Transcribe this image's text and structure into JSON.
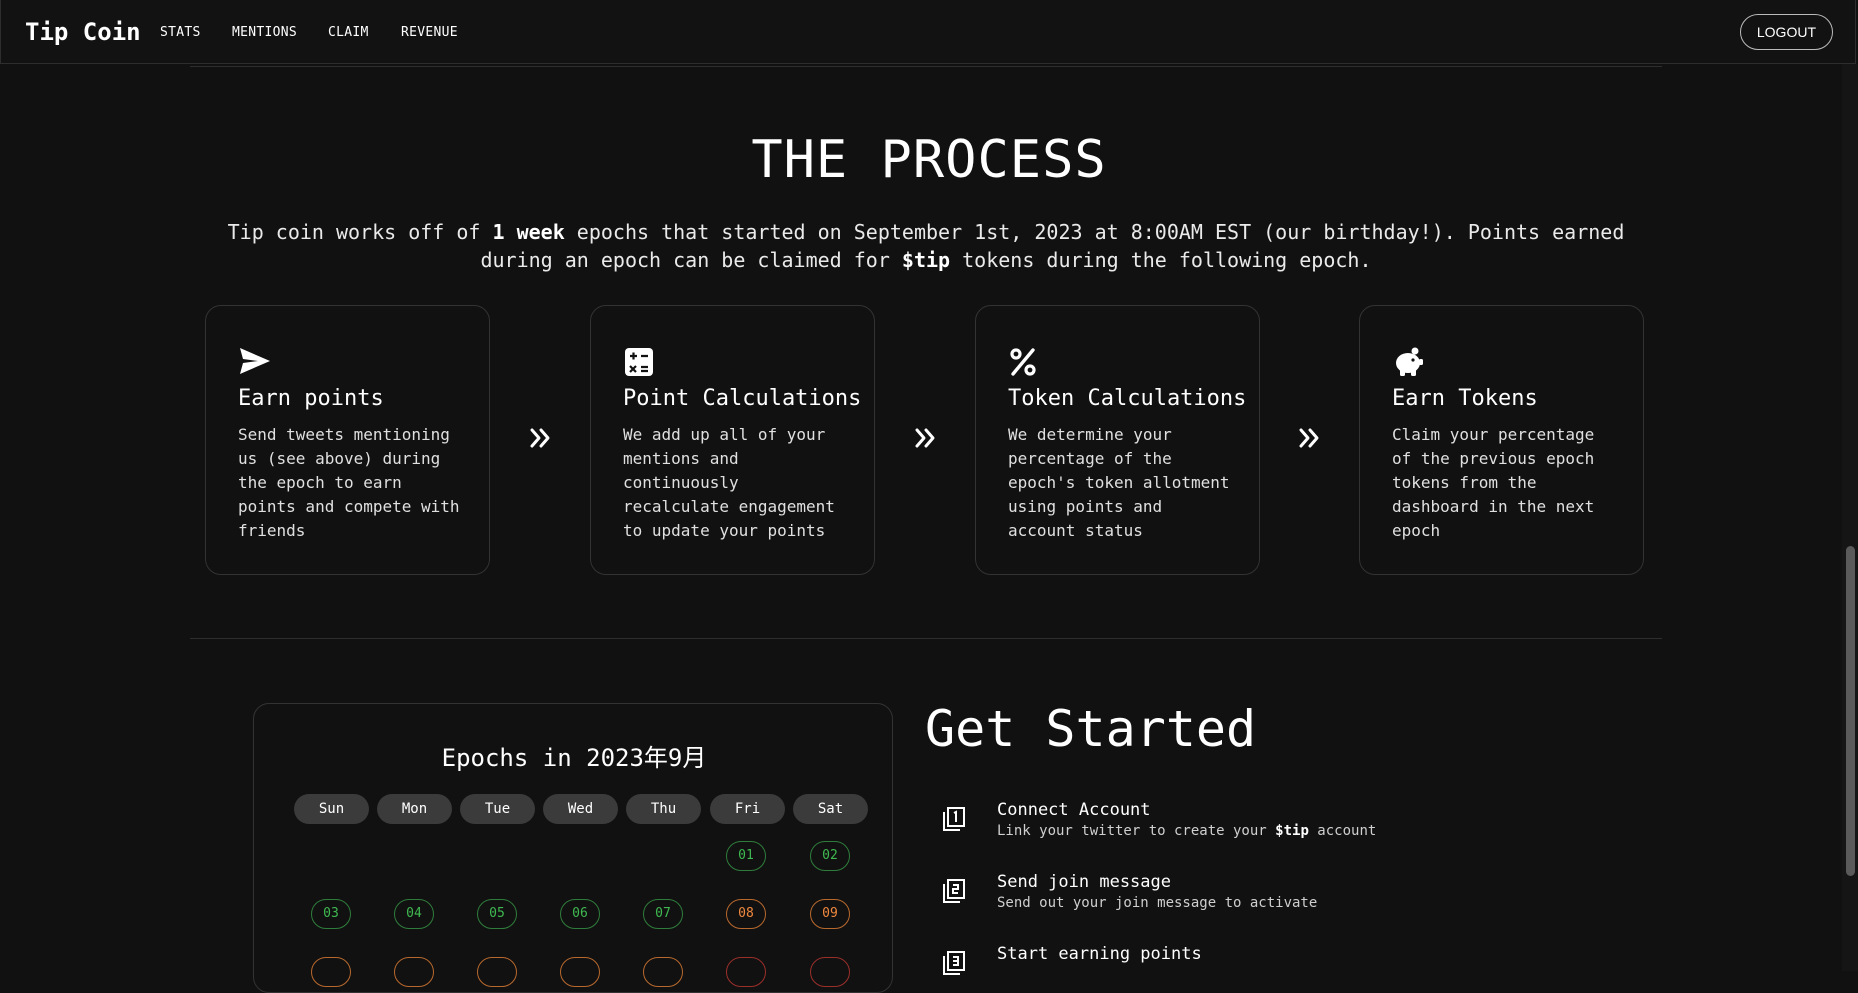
{
  "nav": {
    "brand": "Tip Coin",
    "links": [
      "STATS",
      "MENTIONS",
      "CLAIM",
      "REVENUE"
    ],
    "logout": "LOGOUT"
  },
  "process": {
    "title": "THE PROCESS",
    "desc_1": "Tip coin works off of ",
    "desc_bold_1": "1 week",
    "desc_2": " epochs that started on September 1st, 2023 at 8:00AM EST (our birthday!). Points earned during an epoch can be claimed for ",
    "desc_bold_2": "$tip",
    "desc_3": " tokens during the following epoch.",
    "cards": [
      {
        "icon": "paper-plane-icon",
        "title": "Earn points",
        "text": "Send tweets mentioning us (see above) during the epoch to earn points and compete with friends"
      },
      {
        "icon": "calculator-icon",
        "title": "Point Calculations",
        "text": "We add up all of your mentions and continuously recalculate engagement to update your points"
      },
      {
        "icon": "percent-icon",
        "title": "Token Calculations",
        "text": "We determine your percentage of the epoch's token allotment using points and account status"
      },
      {
        "icon": "piggy-bank-icon",
        "title": "Earn Tokens",
        "text": "Claim your percentage of the previous epoch tokens from the dashboard in the next epoch"
      }
    ]
  },
  "calendar": {
    "title": "Epochs in 2023年9月",
    "days": [
      "Sun",
      "Mon",
      "Tue",
      "Wed",
      "Thu",
      "Fri",
      "Sat"
    ],
    "row1": [
      "01",
      "02"
    ],
    "row2": [
      "03",
      "04",
      "05",
      "06",
      "07",
      "08",
      "09"
    ],
    "colors": {
      "green": "#3fb950",
      "orange": "#f0883e",
      "red": "#e5534b"
    }
  },
  "get_started": {
    "title": "Get Started",
    "steps": [
      {
        "title": "Connect Account",
        "sub_1": "Link your twitter to create your ",
        "sub_bold": "$tip",
        "sub_2": " account"
      },
      {
        "title": "Send join message",
        "sub_1": "Send out your join message to activate"
      },
      {
        "title": "Start earning points"
      }
    ]
  }
}
